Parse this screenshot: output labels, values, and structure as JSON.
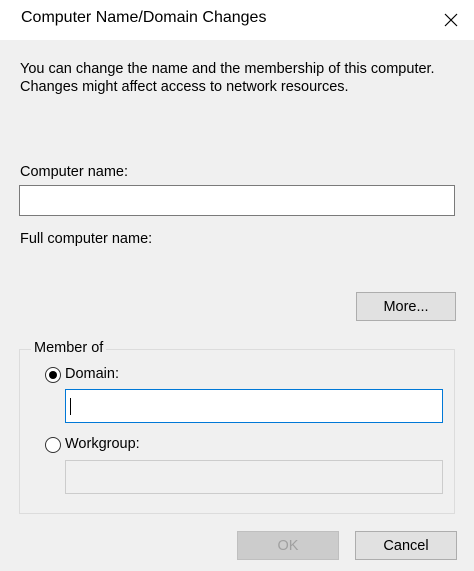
{
  "window": {
    "title": "Computer Name/Domain Changes"
  },
  "description": "You can change the name and the membership of this computer. Changes might affect access to network resources.",
  "computer_name": {
    "label": "Computer name:",
    "value": ""
  },
  "full_computer_name": {
    "label": "Full computer name:",
    "value": ""
  },
  "more_button": "More...",
  "member_of": {
    "legend": "Member of",
    "domain_label": "Domain:",
    "domain_value": "",
    "domain_selected": true,
    "workgroup_label": "Workgroup:",
    "workgroup_value": "",
    "workgroup_selected": false
  },
  "buttons": {
    "ok": "OK",
    "cancel": "Cancel"
  },
  "colors": {
    "focus_border": "#0078d7",
    "dialog_bg": "#f0f0f0"
  }
}
